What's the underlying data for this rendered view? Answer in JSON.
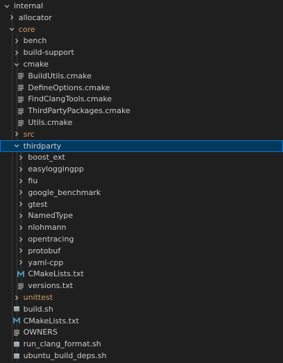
{
  "explorer": {
    "items": [
      {
        "label": "internal",
        "type": "folder",
        "expanded": true
      },
      {
        "label": "allocator",
        "type": "folder",
        "expanded": false
      },
      {
        "label": "core",
        "type": "folder",
        "expanded": true,
        "modified": true
      },
      {
        "label": "bench",
        "type": "folder",
        "expanded": false
      },
      {
        "label": "build-support",
        "type": "folder",
        "expanded": false
      },
      {
        "label": "cmake",
        "type": "folder",
        "expanded": true
      },
      {
        "label": "BuildUtils.cmake",
        "type": "file",
        "icon": "lines-icon"
      },
      {
        "label": "DefineOptions.cmake",
        "type": "file",
        "icon": "lines-icon"
      },
      {
        "label": "FindClangTools.cmake",
        "type": "file",
        "icon": "lines-icon"
      },
      {
        "label": "ThirdPartyPackages.cmake",
        "type": "file",
        "icon": "lines-icon"
      },
      {
        "label": "Utils.cmake",
        "type": "file",
        "icon": "lines-icon"
      },
      {
        "label": "src",
        "type": "folder",
        "expanded": false,
        "modified": true
      },
      {
        "label": "thirdparty",
        "type": "folder",
        "expanded": true,
        "selected": true
      },
      {
        "label": "boost_ext",
        "type": "folder",
        "expanded": false
      },
      {
        "label": "easyloggingpp",
        "type": "folder",
        "expanded": false
      },
      {
        "label": "fiu",
        "type": "folder",
        "expanded": false
      },
      {
        "label": "google_benchmark",
        "type": "folder",
        "expanded": false
      },
      {
        "label": "gtest",
        "type": "folder",
        "expanded": false
      },
      {
        "label": "NamedType",
        "type": "folder",
        "expanded": false
      },
      {
        "label": "nlohmann",
        "type": "folder",
        "expanded": false
      },
      {
        "label": "opentracing",
        "type": "folder",
        "expanded": false
      },
      {
        "label": "protobuf",
        "type": "folder",
        "expanded": false
      },
      {
        "label": "yaml-cpp",
        "type": "folder",
        "expanded": false
      },
      {
        "label": "CMakeLists.txt",
        "type": "file",
        "icon": "cmake-m-icon"
      },
      {
        "label": "versions.txt",
        "type": "file",
        "icon": "lines-icon"
      },
      {
        "label": "unittest",
        "type": "folder",
        "expanded": false,
        "modified": true
      },
      {
        "label": "build.sh",
        "type": "file",
        "icon": "shell-icon"
      },
      {
        "label": "CMakeLists.txt",
        "type": "file",
        "icon": "cmake-m-icon"
      },
      {
        "label": "OWNERS",
        "type": "file",
        "icon": "lines-icon"
      },
      {
        "label": "run_clang_format.sh",
        "type": "file",
        "icon": "shell-icon"
      },
      {
        "label": "ubuntu_build_deps.sh",
        "type": "file",
        "icon": "shell-icon"
      }
    ]
  },
  "colors": {
    "background": "#1f1f1f",
    "text": "#cccccc",
    "modified_text": "#d19a66",
    "selected_bg": "#04395e",
    "selected_border": "#0078d4",
    "cmake_icon": "#519aba",
    "lines_icon": "#c5c5c5",
    "shell_icon": "#9aa4ad"
  }
}
